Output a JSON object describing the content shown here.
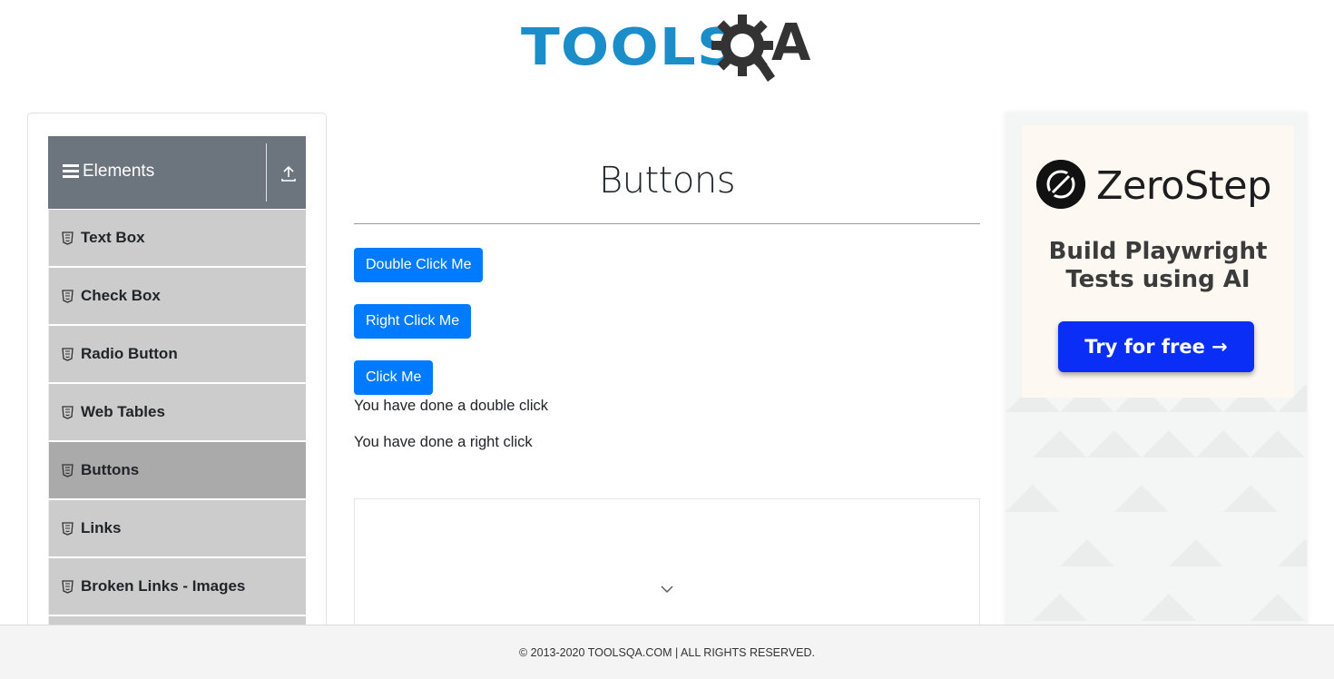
{
  "header": {
    "logo_text_left": "TOOLS",
    "logo_text_right": "A"
  },
  "sidebar": {
    "group_title": "Elements",
    "items": [
      {
        "label": "Text Box",
        "active": false
      },
      {
        "label": "Check Box",
        "active": false
      },
      {
        "label": "Radio Button",
        "active": false
      },
      {
        "label": "Web Tables",
        "active": false
      },
      {
        "label": "Buttons",
        "active": true
      },
      {
        "label": "Links",
        "active": false
      },
      {
        "label": "Broken Links - Images",
        "active": false
      }
    ]
  },
  "main": {
    "title": "Buttons",
    "double_click_label": "Double Click Me",
    "right_click_label": "Right Click Me",
    "click_label": "Click Me",
    "double_click_message": "You have done a double click",
    "right_click_message": "You have done a right click"
  },
  "ad": {
    "brand": "ZeroStep",
    "tagline_line1": "Build Playwright",
    "tagline_line2": "Tests using AI",
    "cta": "Try for free →",
    "cta_color": "#0a2ef5"
  },
  "footer": {
    "text": "© 2013-2020 TOOLSQA.COM | ALL RIGHTS RESERVED."
  },
  "colors": {
    "primary_button": "#007bff",
    "logo_blue": "#1b8ec9",
    "sidebar_header": "#6c757d",
    "menu_item": "#cccccc",
    "menu_item_active": "#aaaaaa"
  }
}
